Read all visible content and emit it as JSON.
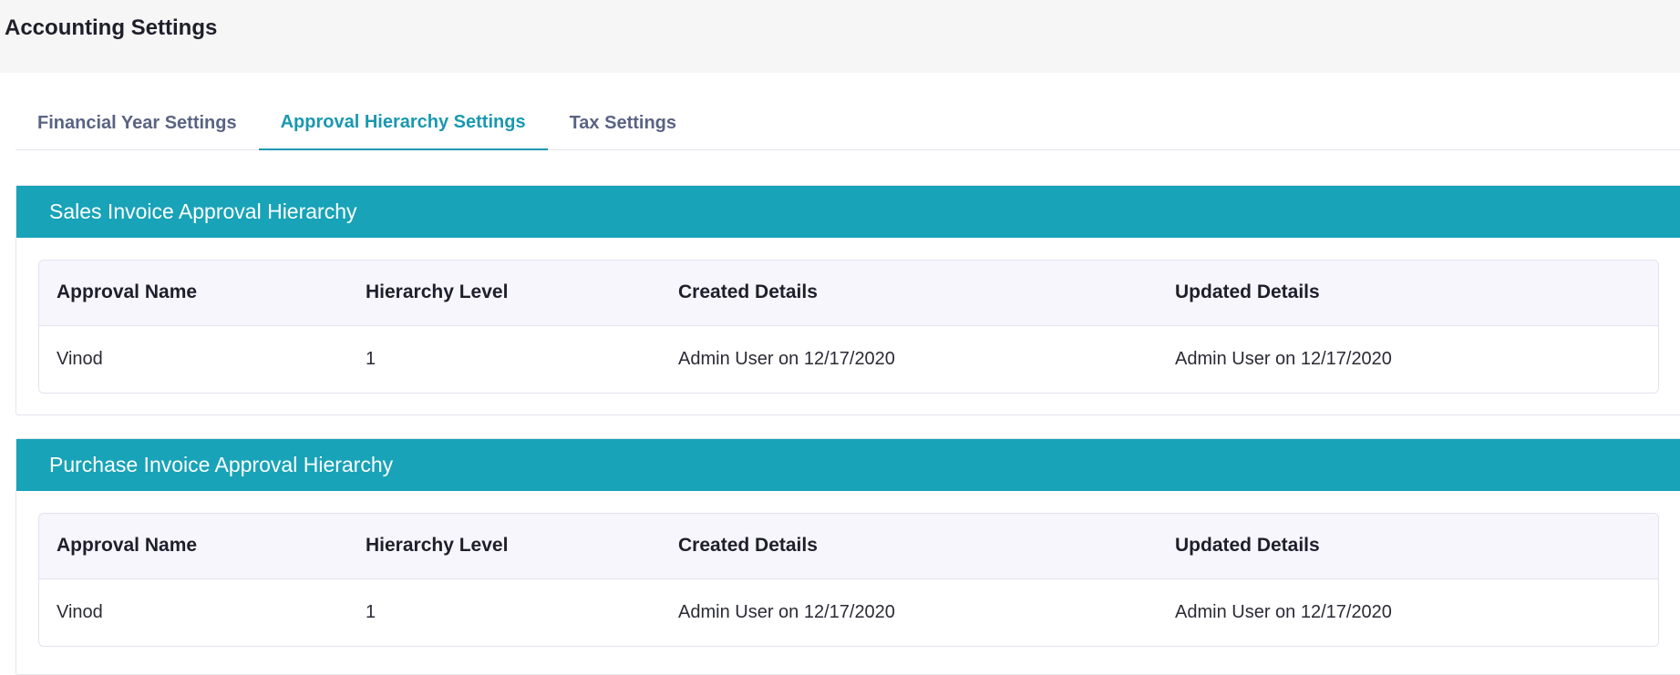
{
  "page": {
    "title": "Accounting Settings"
  },
  "tabs": [
    {
      "label": "Financial Year Settings",
      "active": false
    },
    {
      "label": "Approval Hierarchy Settings",
      "active": true
    },
    {
      "label": "Tax Settings",
      "active": false
    }
  ],
  "colors": {
    "accent": "#18a3b8",
    "active_tab": "#1a98b0",
    "tab_text": "#5a6383",
    "header_bg": "#f6f6f6",
    "table_head_bg": "#f7f6fd"
  },
  "sections": [
    {
      "title": "Sales Invoice Approval Hierarchy",
      "columns": [
        "Approval Name",
        "Hierarchy Level",
        "Created Details",
        "Updated Details"
      ],
      "rows": [
        [
          "Vinod",
          "1",
          "Admin User on 12/17/2020",
          "Admin User on 12/17/2020"
        ]
      ]
    },
    {
      "title": "Purchase Invoice Approval Hierarchy",
      "columns": [
        "Approval Name",
        "Hierarchy Level",
        "Created Details",
        "Updated Details"
      ],
      "rows": [
        [
          "Vinod",
          "1",
          "Admin User on 12/17/2020",
          "Admin User on 12/17/2020"
        ]
      ]
    }
  ]
}
